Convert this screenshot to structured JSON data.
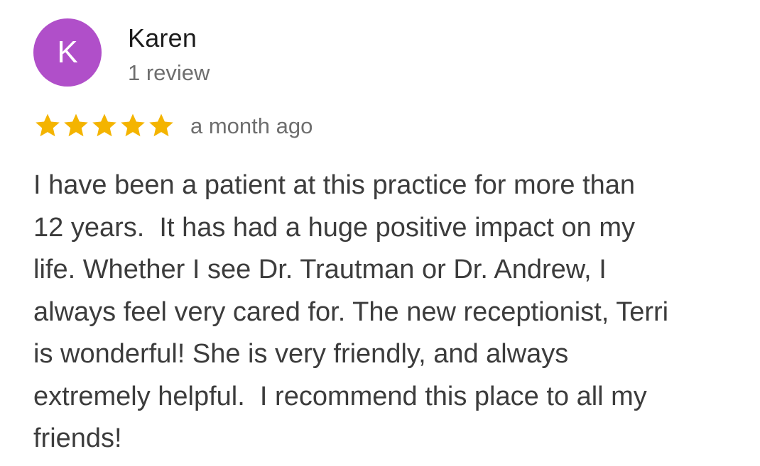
{
  "reviewer": {
    "initial": "K",
    "name": "Karen",
    "review_count": "1 review",
    "avatar_color": "#b04fc9"
  },
  "rating": {
    "stars": 5,
    "max_stars": 5,
    "star_color": "#f4b400",
    "icon": "star-icon",
    "date": "a month ago"
  },
  "review": {
    "lines": [
      "I have been a patient at this practice for more than",
      "12 years.  It has had a huge positive impact on my",
      "life. Whether I see Dr. Trautman or Dr. Andrew, I",
      "always feel very cared for. The new receptionist, Terri",
      "is wonderful! She is very friendly, and always",
      "extremely helpful.  I recommend this place to all my",
      "friends!"
    ]
  }
}
